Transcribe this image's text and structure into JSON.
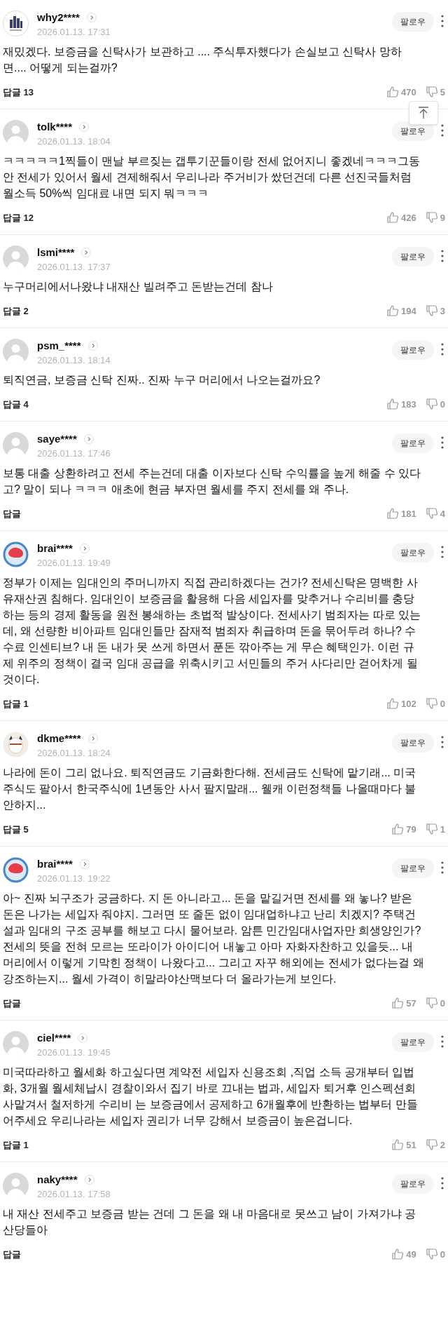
{
  "comments": [
    {
      "kind": "building",
      "user": "why2****",
      "date": "2026.01.13. 17:31",
      "follow": "팔로우",
      "text": "재밌겠다. 보증금을 신탁사가 보관하고 .... 주식투자했다가 손실보고 신탁사 망하면.... 어떻게 되는걸까?",
      "reply_label": "답글",
      "reply_count": "13",
      "likes": "470",
      "dislikes": "5"
    },
    {
      "kind": "default",
      "user": "tolk****",
      "date": "2026.01.13. 18:04",
      "follow": "팔로우",
      "text": "ㅋㅋㅋㅋㅋ1찍들이 맨날 부르짖는 갭투기꾼들이랑 전세 없어지니 좋겠네ㅋㅋㅋ그동안 전세가 있어서 월세 견제해줘서 우리나라 주거비가 쌌던건데 다른 선진국들처럼 월소득 50%씩 임대료 내면 되지 뭐ㅋㅋㅋ",
      "reply_label": "답글",
      "reply_count": "12",
      "likes": "426",
      "dislikes": "9"
    },
    {
      "kind": "default",
      "user": "lsmi****",
      "date": "2026.01.13. 17:37",
      "follow": "팔로우",
      "text": "누구머리에서나왔냐 내재산 빌려주고 돈받는건데 참나",
      "reply_label": "답글",
      "reply_count": "2",
      "likes": "194",
      "dislikes": "3"
    },
    {
      "kind": "default",
      "user": "psm_****",
      "date": "2026.01.13. 18:14",
      "follow": "팔로우",
      "text": "퇴직연금, 보증금 신탁 진짜.. 진짜 누구 머리에서 나오는걸까요?",
      "reply_label": "답글",
      "reply_count": "4",
      "likes": "183",
      "dislikes": "0"
    },
    {
      "kind": "default",
      "user": "saye****",
      "date": "2026.01.13. 17:46",
      "follow": "팔로우",
      "text": "보통 대출 상환하려고 전세 주는건데 대출 이자보다 신탁 수익률을 높게 해줄 수 있다고? 말이 되나 ㅋㅋㅋ 애초에 현금 부자면 월세를 주지 전세를 왜 주나.",
      "reply_label": "답글",
      "likes": "181",
      "dislikes": "4"
    },
    {
      "kind": "globe",
      "user": "brai****",
      "date": "2026.01.13. 19:49",
      "follow": "팔로우",
      "text": "정부가 이제는 임대인의 주머니까지 직접 관리하겠다는 건가? 전세신탁은 명백한 사유재산권 침해다. 임대인이 보증금을 활용해 다음 세입자를 맞추거나 수리비를 충당하는 등의 경제 활동을 원천 봉쇄하는 초법적 발상이다. 전세사기 범죄자는 따로 있는데, 왜 선량한 비아파트 임대인들만 잠재적 범죄자 취급하며 돈을 묶어두려 하나? 수수료 인센티브? 내 돈 내가 못 쓰게 하면서 푼돈 깎아주는 게 무슨 혜택인가. 이런 규제 위주의 정책이 결국 임대 공급을 위축시키고 서민들의 주거 사다리만 걷어차게 될 것이다.",
      "reply_label": "답글",
      "reply_count": "1",
      "likes": "102",
      "dislikes": "0"
    },
    {
      "kind": "character",
      "user": "dkme****",
      "date": "2026.01.13. 18:24",
      "follow": "팔로우",
      "text": "나라에 돈이 그리 없나요. 퇴직연금도 기금화한다해. 전세금도 신탁에 맡기래... 미국주식도 팔아서 한국주식에 1년동안 사서 팔지말래... 웰캐 이런정책들 나올때마다 불안하지...",
      "reply_label": "답글",
      "reply_count": "5",
      "likes": "79",
      "dislikes": "1"
    },
    {
      "kind": "globe",
      "user": "brai****",
      "date": "2026.01.13. 19:22",
      "follow": "팔로우",
      "text": "아~ 진짜 뇌구조가 궁금하다. 지 돈 아니라고... 돈을 맡길거면 전세를 왜 놓나? 받은 돈은 나가는 세입자 줘야지. 그러면 또 줄돈 없이 임대업하냐고 난리 치겠지? 주택건설과 임대의 구조 공부를 해보고 다시 물어보라. 암튼 민간임대사업자만 희생양인가? 전세의 뜻을 전혀 모르는 또라이가 아이디어 내놓고 아마 자화자찬하고 있을듯... 내 머리에서 이렇게 기막힌 정책이 나왔다고... 그리고 자꾸 해외에는 전세가 없다는걸 왜 강조하는지... 월세 가격이 히말라야산맥보다 더 올라가는게 보인다.",
      "reply_label": "답글",
      "likes": "57",
      "dislikes": "0"
    },
    {
      "kind": "default",
      "user": "ciel****",
      "date": "2026.01.13. 19:45",
      "follow": "팔로우",
      "text": "미국따라하고 월세화 하고싶다면 계약전 세입자 신용조회 ,직업 소득 공개부터 입법화, 3개월 월세체납시 경찰이와서 집기 바로 끄내는 법과, 세입자 퇴거후 인스펙션회사맡겨서 철저하게 수리비 는 보증금에서 공제하고 6개월후에 반환하는 법부터 만들어주세요 우리나라는 세입자 권리가 너무 강해서 보증금이 높은겁니다.",
      "reply_label": "답글",
      "reply_count": "1",
      "likes": "51",
      "dislikes": "2"
    },
    {
      "kind": "default",
      "user": "naky****",
      "date": "2026.01.13. 17:58",
      "follow": "팔로우",
      "text": "내 재산 전세주고 보증금 받는 건데 그 돈을 왜 내 마음대로 못쓰고 남이 가져가냐 공산당들아",
      "reply_label": "답글",
      "likes": "49",
      "dislikes": "0"
    }
  ]
}
